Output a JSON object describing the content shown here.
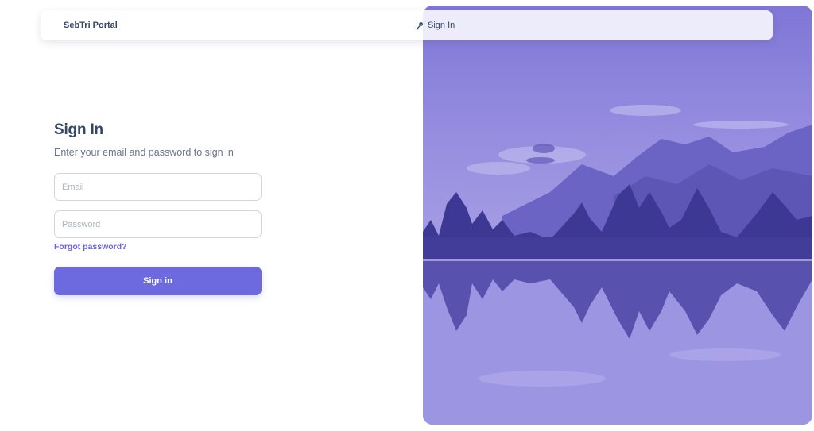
{
  "navbar": {
    "brand": "SebTri Portal",
    "signin_link": "Sign In",
    "signin_icon": "key-icon"
  },
  "form": {
    "title": "Sign In",
    "subtitle": "Enter your email and password to sign in",
    "email_placeholder": "Email",
    "email_value": "",
    "password_placeholder": "Password",
    "password_value": "",
    "forgot_label": "Forgot password?",
    "submit_label": "Sign in"
  },
  "colors": {
    "primary": "#6c6ade",
    "text_dark": "#344767",
    "text_muted": "#67748e",
    "hero_tint": "#8a83db"
  }
}
